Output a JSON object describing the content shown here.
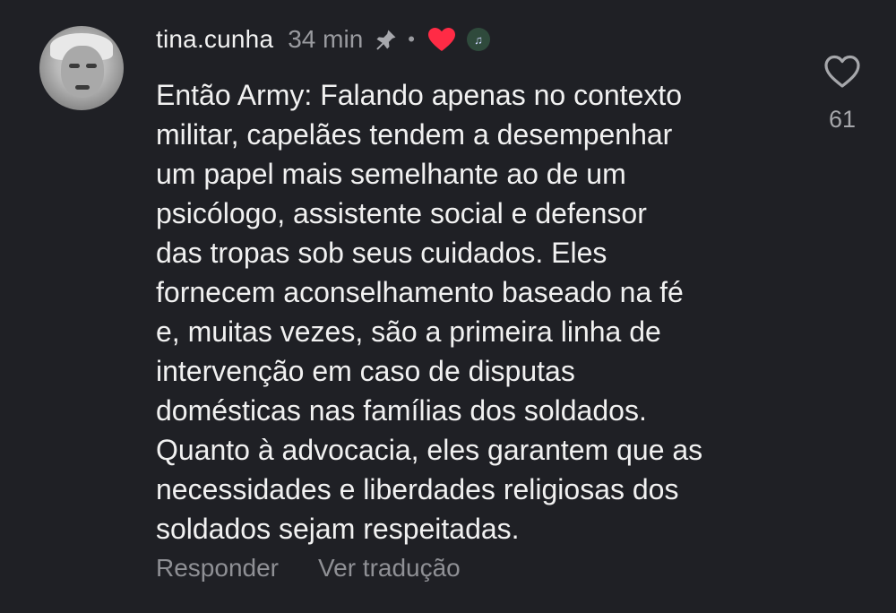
{
  "comment": {
    "author": "tina.cunha",
    "time": "34 min",
    "separator": "•",
    "creator_badge_text": "♫",
    "body_lines": [
      "Então Army: Falando apenas no contexto",
      "militar, capelães tendem a desempenhar",
      "um papel mais semelhante ao de um",
      "psicólogo, assistente social e defensor",
      "das tropas sob seus cuidados. Eles",
      "fornecem aconselhamento baseado na fé",
      "e, muitas vezes, são a primeira linha de",
      "intervenção em caso de disputas",
      "domésticas nas famílias dos soldados.",
      "Quanto à advocacia, eles garantem que as",
      "necessidades e liberdades religiosas dos",
      "soldados sejam respeitadas."
    ],
    "like_count": "61",
    "actions": {
      "reply": "Responder",
      "translate": "Ver tradução"
    }
  },
  "colors": {
    "background": "#1f2025",
    "text": "#f1f1f1",
    "muted": "#9a9ba0",
    "heart_badge": "#ff2b45"
  },
  "icons": {
    "pin": "pin-icon",
    "heart_badge": "heart-icon",
    "like": "heart-outline-icon",
    "avatar": "avatar"
  }
}
